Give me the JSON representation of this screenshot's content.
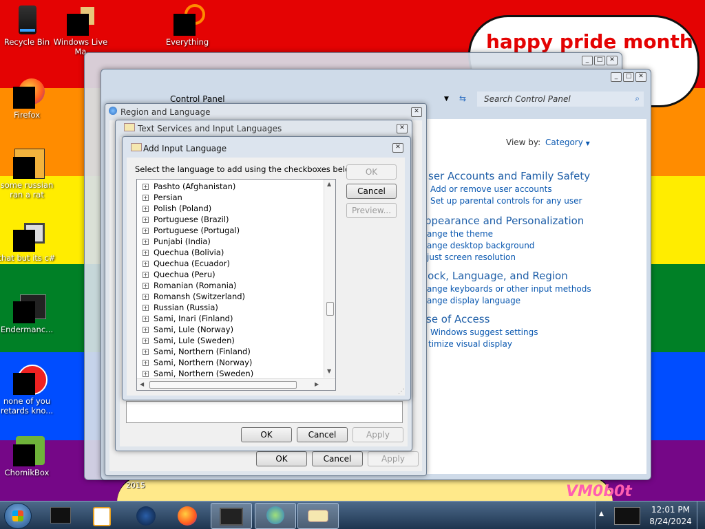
{
  "desktop": {
    "colors": [
      "#e40303",
      "#ff8c00",
      "#ffed00",
      "#008026",
      "#004dff",
      "#750787"
    ],
    "icons": [
      {
        "label": "Recycle Bin",
        "icon": "recycle-bin-icon"
      },
      {
        "label": "Windows Live Ma",
        "icon": "windows-live-mail-icon"
      },
      {
        "label": "Everything",
        "icon": "everything-search-icon"
      },
      {
        "label": "Firefox",
        "icon": "firefox-icon"
      },
      {
        "label": "some russian ran a rat",
        "icon": "app-icon"
      },
      {
        "label": "that but its c#",
        "icon": "app-icon"
      },
      {
        "label": "Endermanc...",
        "icon": "app-icon"
      },
      {
        "label": "none of you retards kno...",
        "icon": "app-icon"
      },
      {
        "label": "ChomikBox",
        "icon": "chomikbox-icon"
      }
    ],
    "bubble_text": "happy pride month",
    "watermark": "VM0b0t",
    "year_label": "2015"
  },
  "control_panel": {
    "breadcrumb": "Control Panel",
    "search_placeholder": "Search Control Panel",
    "view_by_label": "View by:",
    "view_by_value": "Category",
    "sections": [
      {
        "title": "ser Accounts and Family Safety",
        "links": [
          "Add or remove user accounts",
          "Set up parental controls for any user"
        ]
      },
      {
        "title": "ppearance and Personalization",
        "links": [
          "ange the theme",
          "ange desktop background",
          "just screen resolution"
        ]
      },
      {
        "title": "lock, Language, and Region",
        "links": [
          "ange keyboards or other input methods",
          "ange display language"
        ]
      },
      {
        "title": "se of Access",
        "links": [
          "Windows suggest settings",
          "timize visual display"
        ]
      }
    ]
  },
  "region_dialog": {
    "title": "Region and Language",
    "ok": "OK",
    "cancel": "Cancel",
    "apply": "Apply"
  },
  "text_services_dialog": {
    "title": "Text Services and Input Languages",
    "ok": "OK",
    "cancel": "Cancel",
    "apply": "Apply"
  },
  "add_input_dialog": {
    "title": "Add Input Language",
    "instruction": "Select the language to add using the checkboxes below.",
    "ok": "OK",
    "cancel": "Cancel",
    "preview": "Preview...",
    "languages": [
      "Pashto (Afghanistan)",
      "Persian",
      "Polish (Poland)",
      "Portuguese (Brazil)",
      "Portuguese (Portugal)",
      "Punjabi (India)",
      "Quechua (Bolivia)",
      "Quechua (Ecuador)",
      "Quechua (Peru)",
      "Romanian (Romania)",
      "Romansh (Switzerland)",
      "Russian (Russia)",
      "Sami, Inari (Finland)",
      "Sami, Lule (Norway)",
      "Sami, Lule (Sweden)",
      "Sami, Northern (Finland)",
      "Sami, Northern (Norway)",
      "Sami, Northern (Sweden)"
    ]
  },
  "taskbar": {
    "time": "12:01 PM",
    "date": "8/24/2024"
  }
}
